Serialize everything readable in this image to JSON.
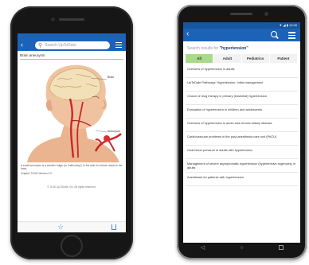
{
  "ios": {
    "search_placeholder": "Search UpToDate",
    "back_glyph": "‹",
    "page_title": "Brain aneurysm",
    "caption": "A small aneurysm is a swollen bulge (or \"ballooning\") in the wall of a blood vessel in the brain.",
    "graphic_ref": "Graphic 74100 Version 2.0",
    "copyright": "© 2016 UpToDate, Inc. All rights reserved.",
    "labels": {
      "brain": "Brain",
      "aneurysm": "Aneurysm",
      "artery": "Artery"
    },
    "toolbar": {
      "star": "☆"
    }
  },
  "android": {
    "status_icons": "▼ ◢ ▮ 12:00",
    "results_prefix": "Search results for",
    "query": "\"hypertension\"",
    "tabs": [
      {
        "label": "All",
        "active": true
      },
      {
        "label": "Adult",
        "active": false
      },
      {
        "label": "Pediatrics",
        "active": false
      },
      {
        "label": "Patient",
        "active": false
      }
    ],
    "results": [
      "Overview of hypertension in adults",
      "UpToDate Pathways: Hypertension: Initial management",
      "Choice of drug therapy in primary (essential) hypertension",
      "Evaluation of hypertension in children and adolescents",
      "Overview of hypertension in acute and chronic kidney disease",
      "Cardiovascular problems in the post-anesthesia care unit (PACU)",
      "Goal blood pressure in adults with hypertension",
      "Management of severe asymptomatic hypertension (hypertensive urgencies) in adults",
      "Anesthesia for patients with hypertension"
    ],
    "nav": {
      "back": "◁",
      "home": "○"
    }
  },
  "colors": {
    "brand_blue": "#1c63b7",
    "tab_active": "#a9d98a"
  }
}
